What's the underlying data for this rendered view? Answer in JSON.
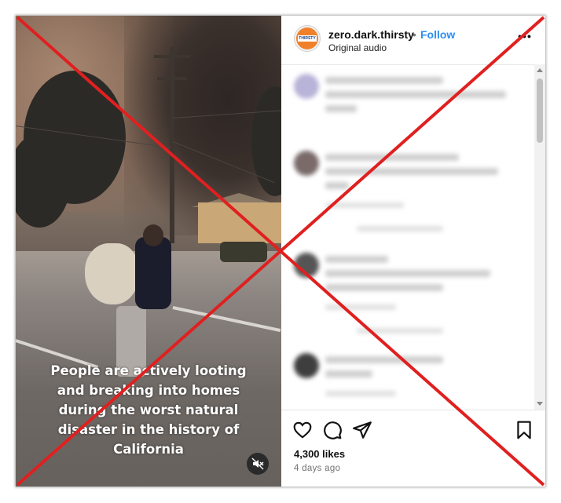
{
  "post": {
    "username": "zero.dark.thirsty",
    "separator": "•",
    "follow_label": "Follow",
    "audio_label": "Original audio",
    "avatar_text": "THIRSTY",
    "more_label": "•••"
  },
  "video": {
    "caption_lines": [
      "People are actively looting",
      "and breaking into homes",
      "during the worst natural",
      "disaster in the history of",
      "California"
    ],
    "muted": true
  },
  "engagement": {
    "likes": "4,300 likes",
    "posted": "4 days ago"
  },
  "icons": {
    "like": "heart-icon",
    "comment": "comment-icon",
    "share": "share-icon",
    "save": "bookmark-icon",
    "mute": "muted-speaker-icon",
    "more": "more-options-icon"
  },
  "colors": {
    "follow": "#2d8ff0",
    "cross_mark": "#e02020",
    "avatar_accent": "#f0812a"
  }
}
